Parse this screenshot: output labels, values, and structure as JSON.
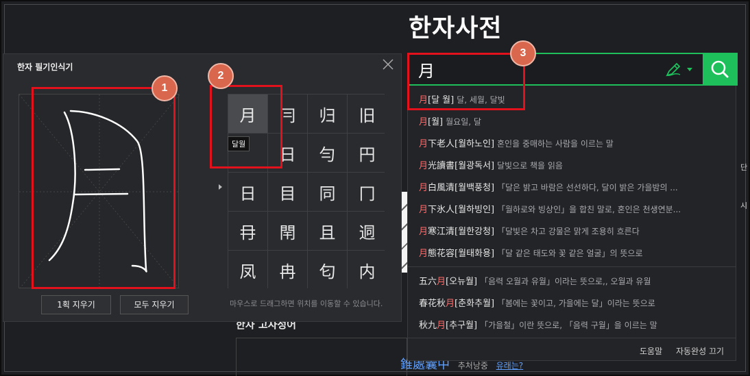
{
  "page": {
    "title": "한자사전"
  },
  "handwriting": {
    "title": "한자 필기인식기",
    "clear_one_label": "1획 지우기",
    "clear_all_label": "모두 지우기",
    "hint": "마우스로 드래그하면 위치를 이동할 수 있습니다.",
    "candidates": [
      "月",
      "冃",
      "归",
      "旧",
      "",
      "日",
      "勻",
      "円",
      "日",
      "目",
      "同",
      "冂",
      "冄",
      "閈",
      "且",
      "迵",
      "凤",
      "冉",
      "匂",
      "内"
    ],
    "tooltip": "달월"
  },
  "search": {
    "value": "月",
    "placeholder": ""
  },
  "autocomplete": {
    "items": [
      {
        "hanja": "月",
        "rest": "",
        "reading": "[달 월]",
        "desc": "달, 세월, 달빛"
      },
      {
        "hanja": "月",
        "rest": "",
        "reading": "[월]",
        "desc": "월요일, 달"
      },
      {
        "hanja": "月",
        "rest": "下老人",
        "reading": "[월하노인]",
        "desc": "혼인을 중매하는 사람을 이르는 말"
      },
      {
        "hanja": "月",
        "rest": "光讀書",
        "reading": "[월광독서]",
        "desc": "달빛으로 책을 읽음"
      },
      {
        "hanja": "月",
        "rest": "白風清",
        "reading": "[월백풍청]",
        "desc": "「달은 밝고 바람은 선선하다, 달이 밝은 가을밤의 ..."
      },
      {
        "hanja": "月",
        "rest": "下氷人",
        "reading": "[월하빙인]",
        "desc": "「월하로와 빙상인」을 합친 말로, 혼인은 천생연분..."
      },
      {
        "hanja": "月",
        "rest": "寒江清",
        "reading": "[월한강청]",
        "desc": "「달빛은 차고 강물은 맑게 조용히 흐른다"
      },
      {
        "hanja": "月",
        "rest": "態花容",
        "reading": "[월태화용]",
        "desc": "「달 같은 태도와 꽃 같은 얼굴」의 뜻으로"
      }
    ],
    "items2": [
      {
        "pre": "五六",
        "hanja": "月",
        "post": "",
        "reading": "[오뉴월]",
        "desc": "「음력 오월과 유월」이라는 뜻으로,, 오월과 유월"
      },
      {
        "pre": "春花秋",
        "hanja": "月",
        "post": "",
        "reading": "[춘화추월]",
        "desc": "「봄에는 꽃이고, 가을에는 달」이라는 뜻으로"
      },
      {
        "pre": "秋九",
        "hanja": "月",
        "post": "",
        "reading": "[추구월]",
        "desc": "「가을철」이란 뜻으로, 「음력 구월」을 이르는 말"
      }
    ],
    "help_label": "도움말",
    "off_label": "자동완성 끄기"
  },
  "background": {
    "section_title": "한자 고사성어",
    "link_hanja": "錐處囊中",
    "link_word": "추처낭중",
    "link_more": "유래는?"
  },
  "annotations": [
    "1",
    "2",
    "3"
  ],
  "colors": {
    "accent": "#1ec05c",
    "highlight": "#e3111b",
    "badge": "#d9674d",
    "hanja_red": "#ff6b6b"
  }
}
